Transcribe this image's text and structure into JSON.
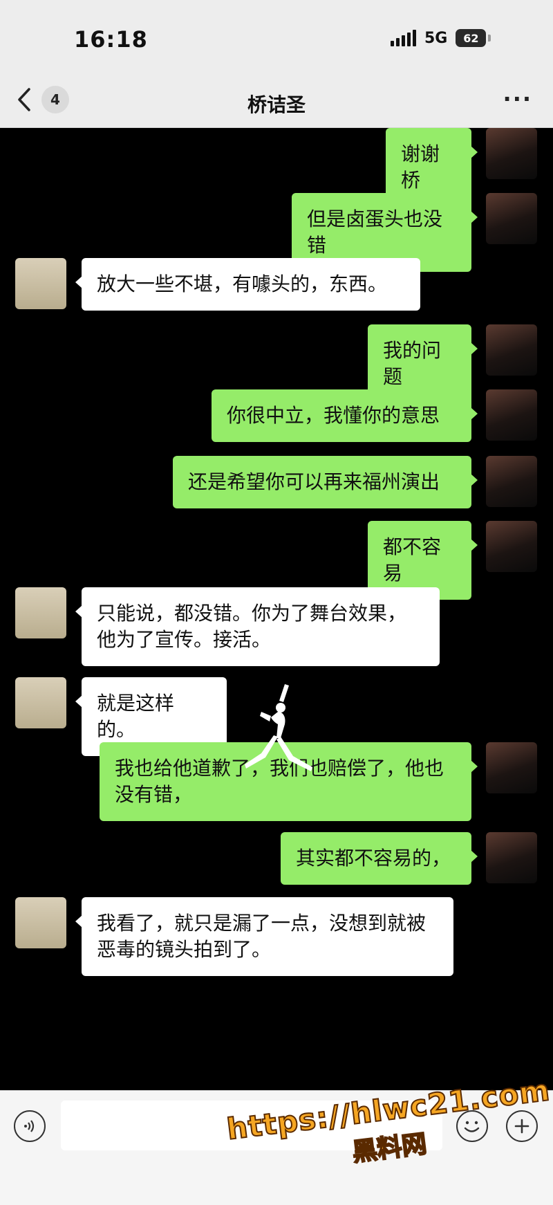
{
  "status_bar": {
    "time": "16:18",
    "network": "5G",
    "battery": "62"
  },
  "nav": {
    "unread_count": "4",
    "title": "桥诘圣",
    "more": "···"
  },
  "messages": [
    {
      "side": "self",
      "text": "谢谢桥"
    },
    {
      "side": "self",
      "text": "但是卤蛋头也没错"
    },
    {
      "side": "other",
      "text": "放大一些不堪，有噱头的，东西。"
    },
    {
      "side": "self",
      "text": "我的问题"
    },
    {
      "side": "self",
      "text": "你很中立，我懂你的意思"
    },
    {
      "side": "self",
      "text": "还是希望你可以再来福州演出"
    },
    {
      "side": "self",
      "text": "都不容易"
    },
    {
      "side": "other",
      "text": "只能说，都没错。你为了舞台效果，他为了宣传。接活。"
    },
    {
      "side": "other",
      "text": "就是这样的。"
    },
    {
      "side": "self",
      "text": "我也给他道歉了，我们也赔偿了，他也没有错，"
    },
    {
      "side": "self",
      "text": "其实都不容易的，"
    },
    {
      "side": "other",
      "text": "我看了，就只是漏了一点，没想到就被恶毒的镜头拍到了。"
    }
  ],
  "input_bar": {
    "placeholder": "",
    "value": ""
  },
  "watermark": {
    "url": "https://hlwc21.com",
    "name": "黑料网"
  },
  "icons": [
    "back-chevron-icon",
    "more-icon",
    "voice-icon",
    "emoji-icon",
    "plus-icon",
    "jumpman-logo"
  ]
}
